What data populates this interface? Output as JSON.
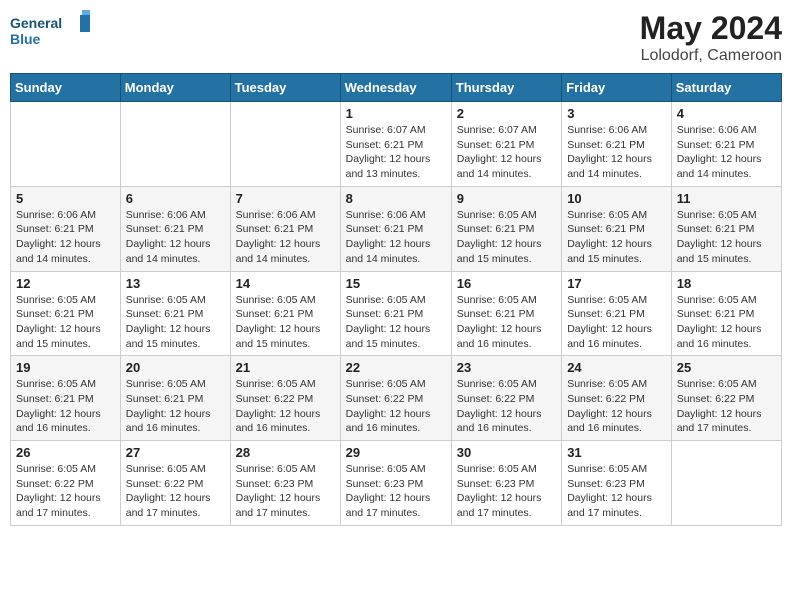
{
  "logo": {
    "line1": "General",
    "line2": "Blue"
  },
  "title": "May 2024",
  "subtitle": "Lolodorf, Cameroon",
  "weekdays": [
    "Sunday",
    "Monday",
    "Tuesday",
    "Wednesday",
    "Thursday",
    "Friday",
    "Saturday"
  ],
  "weeks": [
    [
      {
        "day": "",
        "info": ""
      },
      {
        "day": "",
        "info": ""
      },
      {
        "day": "",
        "info": ""
      },
      {
        "day": "1",
        "info": "Sunrise: 6:07 AM\nSunset: 6:21 PM\nDaylight: 12 hours and 13 minutes."
      },
      {
        "day": "2",
        "info": "Sunrise: 6:07 AM\nSunset: 6:21 PM\nDaylight: 12 hours and 14 minutes."
      },
      {
        "day": "3",
        "info": "Sunrise: 6:06 AM\nSunset: 6:21 PM\nDaylight: 12 hours and 14 minutes."
      },
      {
        "day": "4",
        "info": "Sunrise: 6:06 AM\nSunset: 6:21 PM\nDaylight: 12 hours and 14 minutes."
      }
    ],
    [
      {
        "day": "5",
        "info": "Sunrise: 6:06 AM\nSunset: 6:21 PM\nDaylight: 12 hours and 14 minutes."
      },
      {
        "day": "6",
        "info": "Sunrise: 6:06 AM\nSunset: 6:21 PM\nDaylight: 12 hours and 14 minutes."
      },
      {
        "day": "7",
        "info": "Sunrise: 6:06 AM\nSunset: 6:21 PM\nDaylight: 12 hours and 14 minutes."
      },
      {
        "day": "8",
        "info": "Sunrise: 6:06 AM\nSunset: 6:21 PM\nDaylight: 12 hours and 14 minutes."
      },
      {
        "day": "9",
        "info": "Sunrise: 6:05 AM\nSunset: 6:21 PM\nDaylight: 12 hours and 15 minutes."
      },
      {
        "day": "10",
        "info": "Sunrise: 6:05 AM\nSunset: 6:21 PM\nDaylight: 12 hours and 15 minutes."
      },
      {
        "day": "11",
        "info": "Sunrise: 6:05 AM\nSunset: 6:21 PM\nDaylight: 12 hours and 15 minutes."
      }
    ],
    [
      {
        "day": "12",
        "info": "Sunrise: 6:05 AM\nSunset: 6:21 PM\nDaylight: 12 hours and 15 minutes."
      },
      {
        "day": "13",
        "info": "Sunrise: 6:05 AM\nSunset: 6:21 PM\nDaylight: 12 hours and 15 minutes."
      },
      {
        "day": "14",
        "info": "Sunrise: 6:05 AM\nSunset: 6:21 PM\nDaylight: 12 hours and 15 minutes."
      },
      {
        "day": "15",
        "info": "Sunrise: 6:05 AM\nSunset: 6:21 PM\nDaylight: 12 hours and 15 minutes."
      },
      {
        "day": "16",
        "info": "Sunrise: 6:05 AM\nSunset: 6:21 PM\nDaylight: 12 hours and 16 minutes."
      },
      {
        "day": "17",
        "info": "Sunrise: 6:05 AM\nSunset: 6:21 PM\nDaylight: 12 hours and 16 minutes."
      },
      {
        "day": "18",
        "info": "Sunrise: 6:05 AM\nSunset: 6:21 PM\nDaylight: 12 hours and 16 minutes."
      }
    ],
    [
      {
        "day": "19",
        "info": "Sunrise: 6:05 AM\nSunset: 6:21 PM\nDaylight: 12 hours and 16 minutes."
      },
      {
        "day": "20",
        "info": "Sunrise: 6:05 AM\nSunset: 6:21 PM\nDaylight: 12 hours and 16 minutes."
      },
      {
        "day": "21",
        "info": "Sunrise: 6:05 AM\nSunset: 6:22 PM\nDaylight: 12 hours and 16 minutes."
      },
      {
        "day": "22",
        "info": "Sunrise: 6:05 AM\nSunset: 6:22 PM\nDaylight: 12 hours and 16 minutes."
      },
      {
        "day": "23",
        "info": "Sunrise: 6:05 AM\nSunset: 6:22 PM\nDaylight: 12 hours and 16 minutes."
      },
      {
        "day": "24",
        "info": "Sunrise: 6:05 AM\nSunset: 6:22 PM\nDaylight: 12 hours and 16 minutes."
      },
      {
        "day": "25",
        "info": "Sunrise: 6:05 AM\nSunset: 6:22 PM\nDaylight: 12 hours and 17 minutes."
      }
    ],
    [
      {
        "day": "26",
        "info": "Sunrise: 6:05 AM\nSunset: 6:22 PM\nDaylight: 12 hours and 17 minutes."
      },
      {
        "day": "27",
        "info": "Sunrise: 6:05 AM\nSunset: 6:22 PM\nDaylight: 12 hours and 17 minutes."
      },
      {
        "day": "28",
        "info": "Sunrise: 6:05 AM\nSunset: 6:23 PM\nDaylight: 12 hours and 17 minutes."
      },
      {
        "day": "29",
        "info": "Sunrise: 6:05 AM\nSunset: 6:23 PM\nDaylight: 12 hours and 17 minutes."
      },
      {
        "day": "30",
        "info": "Sunrise: 6:05 AM\nSunset: 6:23 PM\nDaylight: 12 hours and 17 minutes."
      },
      {
        "day": "31",
        "info": "Sunrise: 6:05 AM\nSunset: 6:23 PM\nDaylight: 12 hours and 17 minutes."
      },
      {
        "day": "",
        "info": ""
      }
    ]
  ]
}
